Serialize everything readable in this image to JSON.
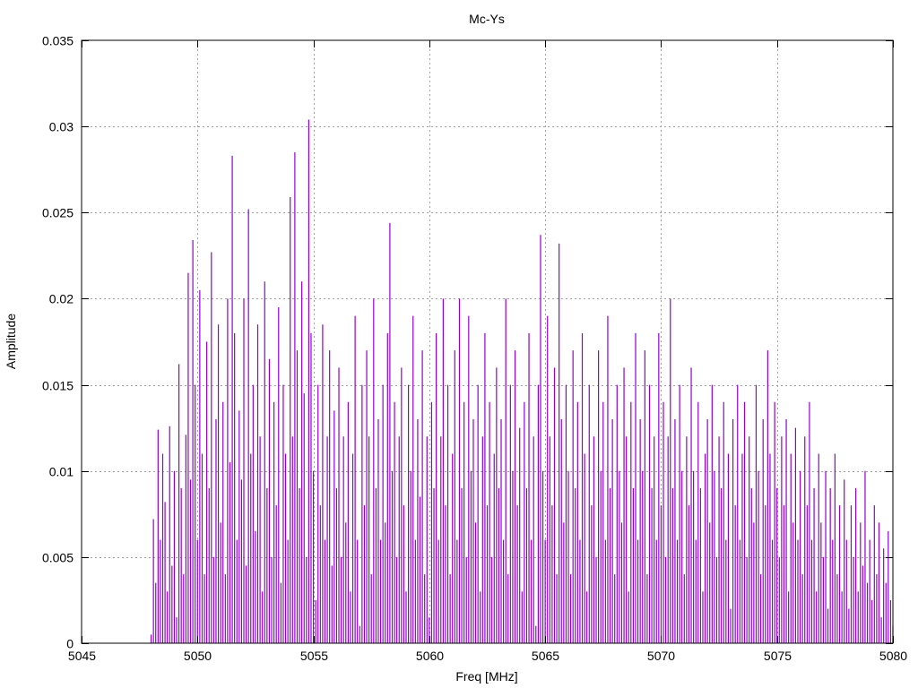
{
  "chart_data": {
    "type": "impulses",
    "title": "Mc-Ys",
    "xlabel": "Freq [MHz]",
    "ylabel": "Amplitude",
    "xlim": [
      5045,
      5080
    ],
    "ylim": [
      0,
      0.035
    ],
    "xticks": [
      5045,
      5050,
      5055,
      5060,
      5065,
      5070,
      5075,
      5080
    ],
    "xtick_labels": [
      "5045",
      "5050",
      "5055",
      "5060",
      "5065",
      "5070",
      "5075",
      "5080"
    ],
    "yticks": [
      0,
      0.005,
      0.01,
      0.015,
      0.02,
      0.025,
      0.03,
      0.035
    ],
    "ytick_labels": [
      "0",
      "0.005",
      "0.01",
      "0.015",
      "0.02",
      "0.025",
      "0.03",
      "0.035"
    ],
    "grid": true,
    "legend": "none",
    "series": [
      {
        "name": "Mc-Ys",
        "color": "#9400d3",
        "x_start": 5048.0,
        "x_step": 0.1,
        "values": [
          0.0005,
          0.0072,
          0.0035,
          0.0124,
          0.006,
          0.011,
          0.0082,
          0.003,
          0.0126,
          0.0045,
          0.01,
          0.0015,
          0.0162,
          0.009,
          0.004,
          0.0121,
          0.0215,
          0.0095,
          0.0234,
          0.015,
          0.006,
          0.0205,
          0.011,
          0.004,
          0.0175,
          0.009,
          0.0227,
          0.005,
          0.013,
          0.0185,
          0.007,
          0.014,
          0.004,
          0.02,
          0.0105,
          0.0283,
          0.018,
          0.006,
          0.0135,
          0.0095,
          0.02,
          0.0045,
          0.0252,
          0.011,
          0.015,
          0.0065,
          0.0185,
          0.012,
          0.003,
          0.021,
          0.009,
          0.0165,
          0.005,
          0.014,
          0.008,
          0.0195,
          0.0035,
          0.015,
          0.011,
          0.006,
          0.0259,
          0.012,
          0.0285,
          0.017,
          0.009,
          0.021,
          0.0145,
          0.005,
          0.0304,
          0.018,
          0.01,
          0.0025,
          0.015,
          0.008,
          0.0185,
          0.006,
          0.012,
          0.017,
          0.0045,
          0.0135,
          0.009,
          0.016,
          0.005,
          0.012,
          0.007,
          0.014,
          0.003,
          0.011,
          0.019,
          0.006,
          0.001,
          0.015,
          0.008,
          0.017,
          0.012,
          0.004,
          0.02,
          0.009,
          0.013,
          0.006,
          0.015,
          0.007,
          0.018,
          0.0244,
          0.01,
          0.014,
          0.005,
          0.012,
          0.016,
          0.008,
          0.003,
          0.015,
          0.01,
          0.019,
          0.006,
          0.013,
          0.0085,
          0.017,
          0.004,
          0.012,
          0.0015,
          0.014,
          0.009,
          0.018,
          0.006,
          0.012,
          0.02,
          0.008,
          0.015,
          0.004,
          0.011,
          0.017,
          0.006,
          0.02,
          0.009,
          0.014,
          0.005,
          0.019,
          0.01,
          0.013,
          0.007,
          0.015,
          0.003,
          0.012,
          0.018,
          0.008,
          0.014,
          0.005,
          0.011,
          0.016,
          0.009,
          0.013,
          0.006,
          0.02,
          0.004,
          0.015,
          0.01,
          0.017,
          0.008,
          0.0125,
          0.003,
          0.014,
          0.009,
          0.018,
          0.006,
          0.012,
          0.001,
          0.015,
          0.0237,
          0.01,
          0.006,
          0.019,
          0.012,
          0.008,
          0.016,
          0.004,
          0.0232,
          0.013,
          0.007,
          0.015,
          0.01,
          0.004,
          0.017,
          0.009,
          0.014,
          0.006,
          0.018,
          0.011,
          0.003,
          0.015,
          0.008,
          0.012,
          0.005,
          0.017,
          0.01,
          0.014,
          0.006,
          0.019,
          0.009,
          0.013,
          0.004,
          0.015,
          0.01,
          0.007,
          0.016,
          0.012,
          0.003,
          0.014,
          0.009,
          0.018,
          0.006,
          0.013,
          0.01,
          0.017,
          0.004,
          0.015,
          0.009,
          0.012,
          0.006,
          0.018,
          0.008,
          0.014,
          0.005,
          0.012,
          0.02,
          0.009,
          0.013,
          0.006,
          0.015,
          0.01,
          0.004,
          0.012,
          0.008,
          0.016,
          0.01,
          0.006,
          0.014,
          0.009,
          0.003,
          0.011,
          0.013,
          0.007,
          0.015,
          0.01,
          0.005,
          0.012,
          0.009,
          0.014,
          0.006,
          0.011,
          0.002,
          0.013,
          0.008,
          0.015,
          0.006,
          0.011,
          0.014,
          0.005,
          0.012,
          0.009,
          0.007,
          0.015,
          0.01,
          0.004,
          0.013,
          0.008,
          0.017,
          0.011,
          0.006,
          0.014,
          0.009,
          0.005,
          0.012,
          0.008,
          0.013,
          0.003,
          0.011,
          0.007,
          0.0125,
          0.006,
          0.01,
          0.004,
          0.012,
          0.008,
          0.014,
          0.006,
          0.009,
          0.003,
          0.011,
          0.007,
          0.005,
          0.01,
          0.002,
          0.009,
          0.006,
          0.011,
          0.004,
          0.008,
          0.003,
          0.0095,
          0.006,
          0.002,
          0.008,
          0.005,
          0.009,
          0.003,
          0.007,
          0.0045,
          0.01,
          0.0035,
          0.006,
          0.0025,
          0.008,
          0.004,
          0.007,
          0.0015,
          0.0055,
          0.0035,
          0.0065,
          0.0025,
          0.001
        ]
      }
    ]
  }
}
